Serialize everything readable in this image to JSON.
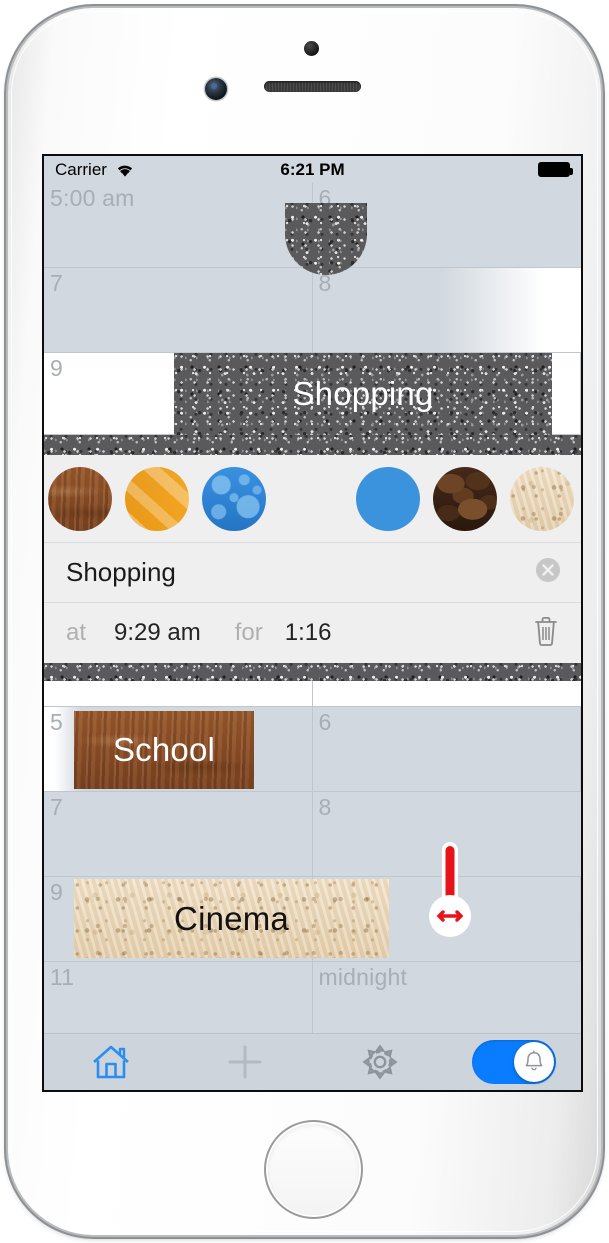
{
  "device": {
    "name": "iphone-white",
    "icons": {
      "camera": "front-camera",
      "sensor": "proximity-sensor",
      "speaker": "earpiece-speaker",
      "home": "home-button"
    }
  },
  "status_bar": {
    "carrier": "Carrier",
    "wifi_icon": "wifi-icon",
    "time": "6:21 PM",
    "battery_icon": "battery-full-icon"
  },
  "top_calendar": {
    "rows": [
      {
        "left": {
          "label": "5:00 am",
          "style": "empty"
        },
        "right": {
          "label": "6",
          "style": "empty"
        }
      },
      {
        "left": {
          "label": "7",
          "style": "empty"
        },
        "right": {
          "label": "8",
          "style": "fade-white"
        }
      },
      {
        "left": {
          "label": "9",
          "style": "white"
        },
        "right": {
          "label": "",
          "style": "white"
        }
      }
    ],
    "event": {
      "title": "Shopping",
      "texture": "asphalt",
      "text_color": "#ffffff"
    }
  },
  "color_picker": {
    "swatches": [
      {
        "name": "wood",
        "texture": "wood",
        "color": "#8b4f26",
        "selected": false
      },
      {
        "name": "orange",
        "texture": "orange",
        "color": "#f5a623",
        "selected": false
      },
      {
        "name": "bubbles",
        "texture": "bubbles",
        "color": "#2e86d8",
        "selected": false
      },
      {
        "name": "asphalt",
        "texture": "asphalt",
        "color": "#5a5a5d",
        "selected": true
      },
      {
        "name": "blue",
        "texture": "solid",
        "color": "#3b93dd",
        "selected": false
      },
      {
        "name": "coffee",
        "texture": "coffee",
        "color": "#3a2315",
        "selected": false
      },
      {
        "name": "cork",
        "texture": "cork",
        "color": "#ecd9bc",
        "selected": false
      }
    ]
  },
  "event_detail": {
    "title": "Shopping",
    "clear_icon": "clear-circle-icon",
    "at_label": "at",
    "start_time": "9:29 am",
    "for_label": "for",
    "duration": "1:16",
    "delete_icon": "trash-icon"
  },
  "bottom_calendar": {
    "rows": [
      {
        "left": {
          "label": "5",
          "style": "white-fade"
        },
        "right": {
          "label": "6",
          "style": "empty"
        }
      },
      {
        "left": {
          "label": "7",
          "style": "empty"
        },
        "right": {
          "label": "8",
          "style": "empty"
        }
      },
      {
        "left": {
          "label": "9",
          "style": "empty"
        },
        "right": {
          "label": "",
          "style": "empty"
        }
      },
      {
        "left": {
          "label": "11",
          "style": "empty"
        },
        "right": {
          "label": "midnight",
          "style": "empty"
        }
      }
    ],
    "events": [
      {
        "title": "School",
        "texture": "wood",
        "text_color": "#ffffff"
      },
      {
        "title": "Cinema",
        "texture": "cork",
        "text_color": "#121212"
      }
    ],
    "drag_handle": {
      "name": "resize-handle",
      "color": "#e8131a",
      "icon": "arrows-horizontal-icon"
    }
  },
  "toolbar": {
    "items": [
      {
        "name": "home",
        "icon": "home-icon",
        "color": "#2a8ef0"
      },
      {
        "name": "add",
        "icon": "plus-icon",
        "color": "#b4bac1"
      },
      {
        "name": "settings",
        "icon": "gear-icon",
        "color": "#8e949b"
      }
    ],
    "toggle": {
      "name": "alerts-toggle",
      "state": "on",
      "icon": "bell-icon",
      "color": "#0a7cff"
    }
  }
}
